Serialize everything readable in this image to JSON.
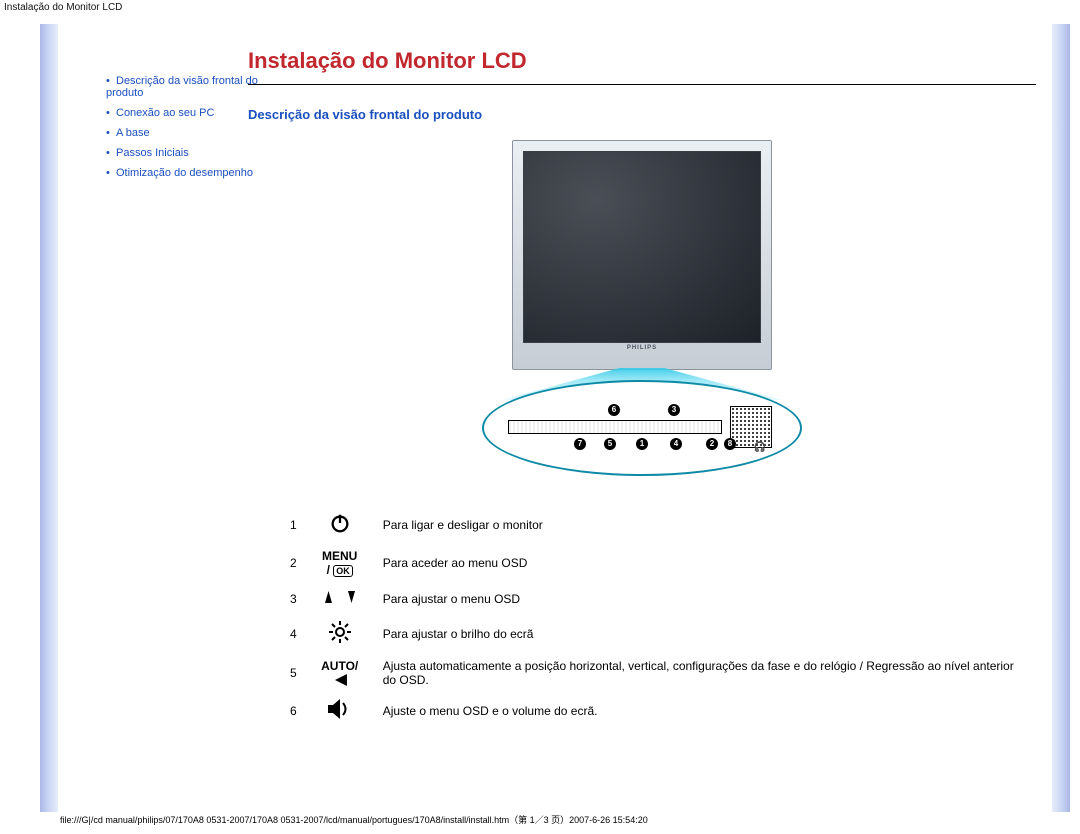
{
  "doc_title": "Instalação do Monitor LCD",
  "page_title": "Instalação do Monitor LCD",
  "section_title": "Descrição da visão frontal do produto",
  "sidebar": {
    "items": [
      {
        "label": "Descrição da visão frontal do produto"
      },
      {
        "label": "Conexão ao seu PC"
      },
      {
        "label": "A base"
      },
      {
        "label": "Passos Iniciais"
      },
      {
        "label": "Otimização do desempenho"
      }
    ]
  },
  "brand": "PHILIPS",
  "panel": {
    "nums": [
      "1",
      "2",
      "3",
      "4",
      "5",
      "6",
      "7",
      "8"
    ],
    "headphones": "♫"
  },
  "legend": [
    {
      "num": "1",
      "icon": "power",
      "text": "Para ligar e desligar o monitor"
    },
    {
      "num": "2",
      "icon": "menu",
      "text": "Para aceder ao menu OSD"
    },
    {
      "num": "3",
      "icon": "updown",
      "text": "Para ajustar o menu OSD"
    },
    {
      "num": "4",
      "icon": "bright",
      "text": "Para ajustar o brilho do ecrã"
    },
    {
      "num": "5",
      "icon": "auto",
      "text": "Ajusta automaticamente a posição horizontal, vertical, configurações da fase e do relógio / Regressão ao nível anterior do OSD."
    },
    {
      "num": "6",
      "icon": "volume",
      "text": "Ajuste o menu OSD e o volume do ecrã."
    }
  ],
  "labels": {
    "menu": "MENU /",
    "ok": "OK",
    "auto": "AUTO/"
  },
  "footer": "file:///G|/cd manual/philips/07/170A8 0531-2007/170A8 0531-2007/lcd/manual/portugues/170A8/install/install.htm（第 1／3 页）2007-6-26 15:54:20"
}
